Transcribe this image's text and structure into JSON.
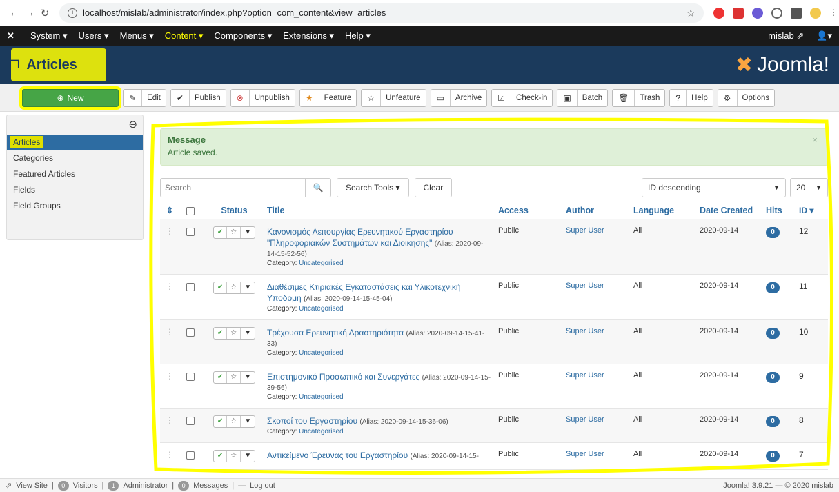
{
  "browser": {
    "url": "localhost/mislab/administrator/index.php?option=com_content&view=articles"
  },
  "adminnav": {
    "items": [
      "System ▾",
      "Users ▾",
      "Menus ▾",
      "Content ▾",
      "Components ▾",
      "Extensions ▾",
      "Help ▾"
    ],
    "user": "mislab"
  },
  "header": {
    "title": "Articles",
    "brand": "Joomla!"
  },
  "toolbar": {
    "new": "New",
    "buttons": [
      "Edit",
      "Publish",
      "Unpublish",
      "Feature",
      "Unfeature",
      "Archive",
      "Check-in",
      "Batch",
      "Trash",
      "Help",
      "Options"
    ]
  },
  "sidebar": {
    "items": [
      "Articles",
      "Categories",
      "Featured Articles",
      "Fields",
      "Field Groups"
    ]
  },
  "alert": {
    "heading": "Message",
    "message": "Article saved."
  },
  "filters": {
    "search_placeholder": "Search",
    "search_tools": "Search Tools ▾",
    "clear": "Clear",
    "order": "ID descending",
    "limit": "20"
  },
  "table": {
    "headers": [
      "Status",
      "Title",
      "Access",
      "Author",
      "Language",
      "Date Created",
      "Hits",
      "ID ▾"
    ],
    "rows": [
      {
        "title": "Κανονισμός Λειτουργίας Ερευνητικού Εργαστηρίου \"Πληροφοριακών Συστημάτων και Διοικησης\"",
        "alias": "(Alias: 2020-09-14-15-52-56)",
        "category": "Uncategorised",
        "access": "Public",
        "author": "Super User",
        "language": "All",
        "date": "2020-09-14",
        "hits": "0",
        "id": "12"
      },
      {
        "title": "Διαθέσιμες Κτιριακές Εγκαταστάσεις και Υλικοτεχνική Υποδομή",
        "alias": "(Alias: 2020-09-14-15-45-04)",
        "category": "Uncategorised",
        "access": "Public",
        "author": "Super User",
        "language": "All",
        "date": "2020-09-14",
        "hits": "0",
        "id": "11"
      },
      {
        "title": "Τρέχουσα Ερευνητική Δραστηριότητα",
        "alias": "(Alias: 2020-09-14-15-41-33)",
        "category": "Uncategorised",
        "access": "Public",
        "author": "Super User",
        "language": "All",
        "date": "2020-09-14",
        "hits": "0",
        "id": "10"
      },
      {
        "title": "Επιστημονικό Προσωπικό και Συνεργάτες",
        "alias": "(Alias: 2020-09-14-15-39-56)",
        "category": "Uncategorised",
        "access": "Public",
        "author": "Super User",
        "language": "All",
        "date": "2020-09-14",
        "hits": "0",
        "id": "9"
      },
      {
        "title": "Σκοποί του Εργαστηρίου",
        "alias": "(Alias: 2020-09-14-15-36-06)",
        "category": "Uncategorised",
        "access": "Public",
        "author": "Super User",
        "language": "All",
        "date": "2020-09-14",
        "hits": "0",
        "id": "8"
      },
      {
        "title": "Αντικείμενο Έρευνας του Εργαστηρίου",
        "alias": "(Alias: 2020-09-14-15-",
        "category": "",
        "access": "Public",
        "author": "Super User",
        "language": "All",
        "date": "2020-09-14",
        "hits": "0",
        "id": "7"
      }
    ]
  },
  "statusbar": {
    "view_site": "View Site",
    "visitors_count": "0",
    "visitors": "Visitors",
    "admin_count": "1",
    "admin": "Administrator",
    "messages_count": "0",
    "messages": "Messages",
    "logout": "Log out",
    "version": "Joomla! 3.9.21 — © 2020 mislab"
  },
  "colors": {
    "highlight": "#ffff00",
    "header_bg": "#1b3a5c",
    "accent": "#2d6ca2",
    "success": "#46a546"
  }
}
